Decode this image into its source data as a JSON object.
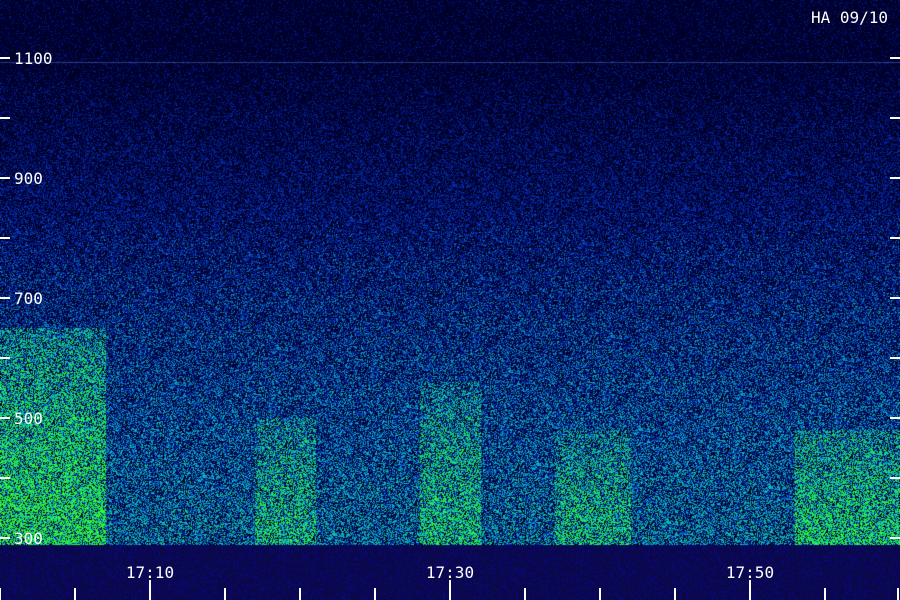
{
  "chart_data": {
    "type": "heatmap",
    "title": "HA 09/10",
    "y_ticks": [
      1100,
      900,
      700,
      500,
      300
    ],
    "y_minor_ticks": [
      1000,
      800,
      600,
      400
    ],
    "ylim": [
      300,
      1100
    ],
    "x_ticks": [
      "17:10",
      "17:30",
      "17:50"
    ],
    "x_tick_minutes": [
      10,
      30,
      50
    ],
    "x_minor_minutes": [
      0,
      5,
      15,
      20,
      25,
      35,
      40,
      45,
      55,
      60
    ],
    "xlim_minutes": [
      0,
      60
    ],
    "grid": false,
    "colors": {
      "background": "#000033",
      "low": "#0a0a8c",
      "mid": "#1ea0c8",
      "high": "#28e650",
      "axis": "#ffffff"
    },
    "bright_regions": [
      {
        "t_start": 0,
        "t_end": 6,
        "y_low": 300,
        "y_high": 650,
        "level": 0.85
      },
      {
        "t_start": 18,
        "t_end": 20,
        "y_low": 300,
        "y_high": 500,
        "level": 0.45
      },
      {
        "t_start": 29,
        "t_end": 31,
        "y_low": 300,
        "y_high": 560,
        "level": 0.5
      },
      {
        "t_start": 38,
        "t_end": 41,
        "y_low": 300,
        "y_high": 480,
        "level": 0.45
      },
      {
        "t_start": 54,
        "t_end": 60,
        "y_low": 300,
        "y_high": 480,
        "level": 0.6
      }
    ]
  }
}
